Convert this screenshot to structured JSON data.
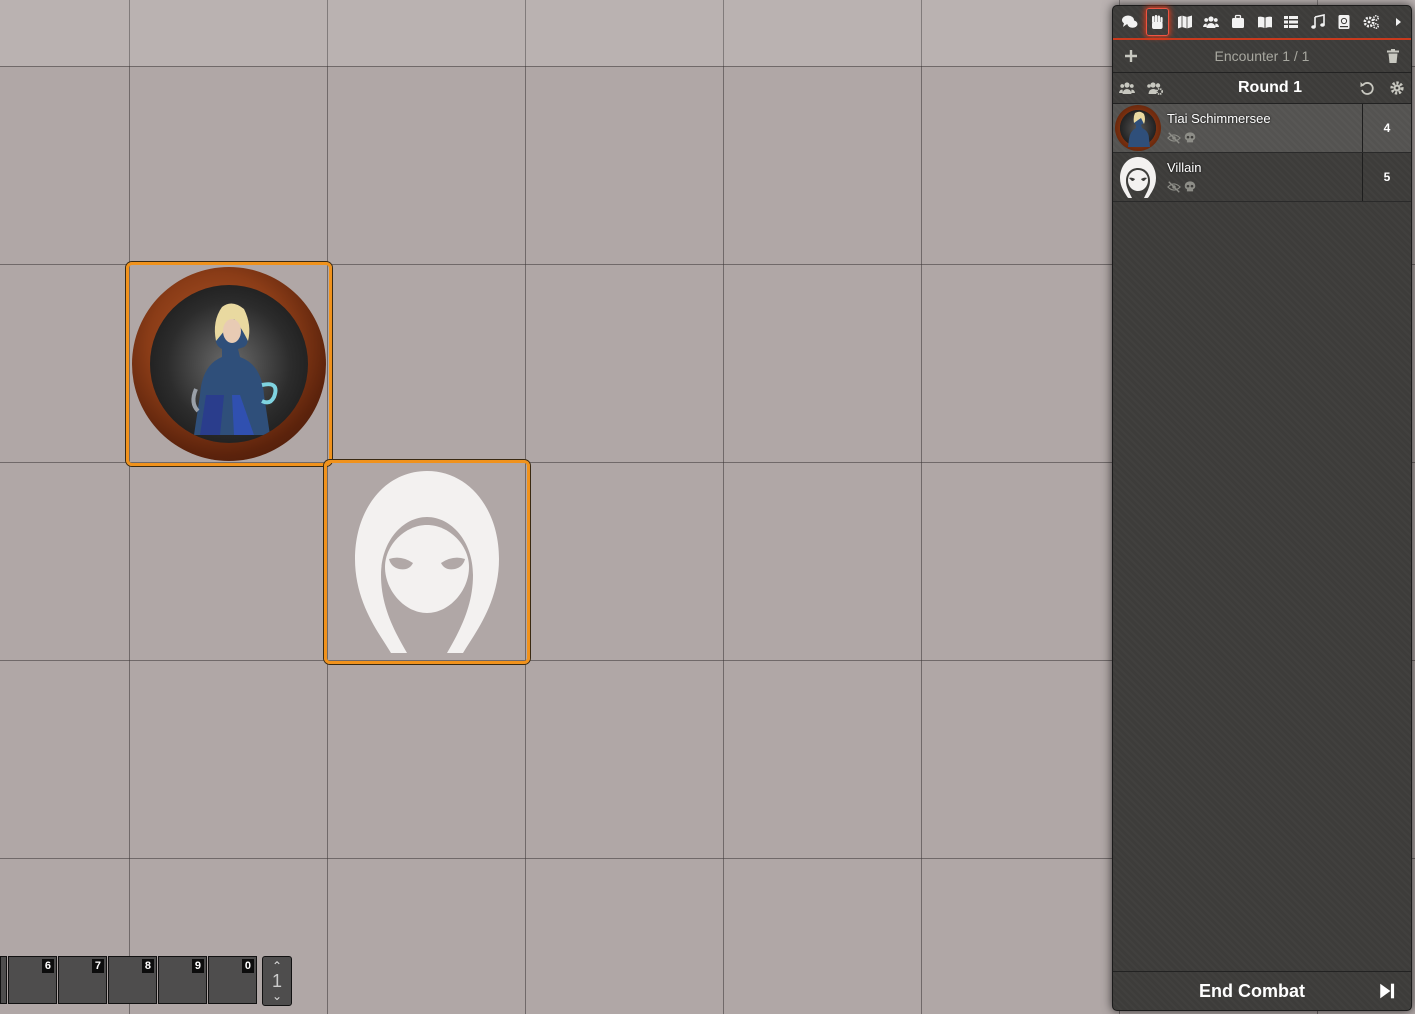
{
  "sidebar": {
    "tabs": [
      {
        "name": "chat",
        "icon": "comments-icon"
      },
      {
        "name": "combat",
        "icon": "fist-raised-icon",
        "active": true
      },
      {
        "name": "scenes",
        "icon": "map-icon"
      },
      {
        "name": "actors",
        "icon": "users-icon"
      },
      {
        "name": "items",
        "icon": "suitcase-icon"
      },
      {
        "name": "journal",
        "icon": "book-open-icon"
      },
      {
        "name": "tables",
        "icon": "th-list-icon"
      },
      {
        "name": "playlists",
        "icon": "music-icon"
      },
      {
        "name": "compendium",
        "icon": "atlas-icon"
      },
      {
        "name": "settings",
        "icon": "cogs-icon"
      },
      {
        "name": "collapse",
        "icon": "caret-right-icon"
      }
    ],
    "accent_color": "#c93a1d",
    "encounter_title": "Encounter 1 / 1",
    "round_title": "Round 1",
    "combatants": [
      {
        "name": "Tiai Schimmersee",
        "initiative": "4",
        "active": true
      },
      {
        "name": "Villain",
        "initiative": "5",
        "active": false
      }
    ],
    "end_combat_label": "End Combat"
  },
  "hotbar": {
    "slots": [
      "",
      "6",
      "7",
      "8",
      "9",
      "0"
    ],
    "page": "1"
  },
  "canvas": {
    "token_border_color": "#f0921c"
  }
}
